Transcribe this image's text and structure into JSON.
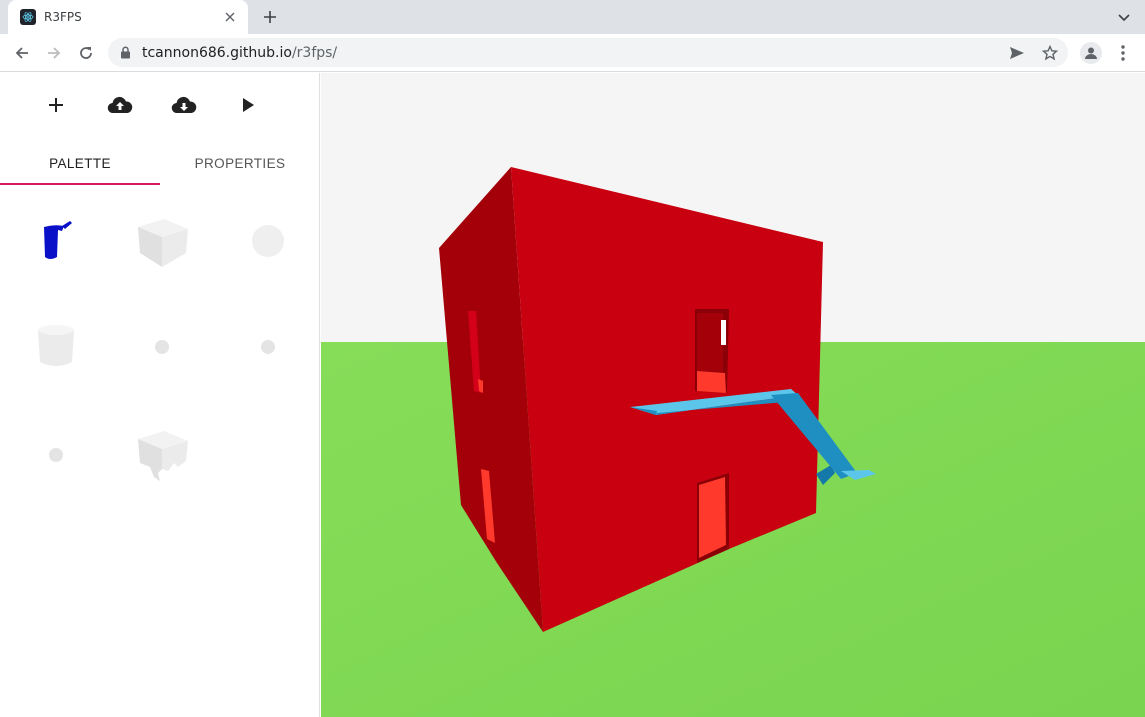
{
  "browser": {
    "tab_title": "R3FPS",
    "url_host": "tcannon686.github.io",
    "url_path": "/r3fps/"
  },
  "app": {
    "actions": [
      {
        "icon": "plus-icon"
      },
      {
        "icon": "cloud-upload-icon"
      },
      {
        "icon": "cloud-download-icon"
      },
      {
        "icon": "play-icon"
      }
    ],
    "tabs": [
      {
        "label": "PALETTE",
        "active": true
      },
      {
        "label": "PROPERTIES",
        "active": false
      }
    ],
    "palette": [
      {
        "icon": "blue-faucet-icon"
      },
      {
        "icon": "cube-icon"
      },
      {
        "icon": "sphere-icon"
      },
      {
        "icon": "cylinder-icon"
      },
      {
        "icon": "small-dot-icon"
      },
      {
        "icon": "small-dot-icon"
      },
      {
        "icon": "small-dot-icon"
      },
      {
        "icon": "ruined-cube-icon"
      }
    ],
    "colors": {
      "accent": "#d81b60",
      "sky": "#f5f5f5",
      "ground": "#7fd955",
      "house_red": "#c8000f",
      "slide_blue": "#1e8fc0"
    }
  }
}
